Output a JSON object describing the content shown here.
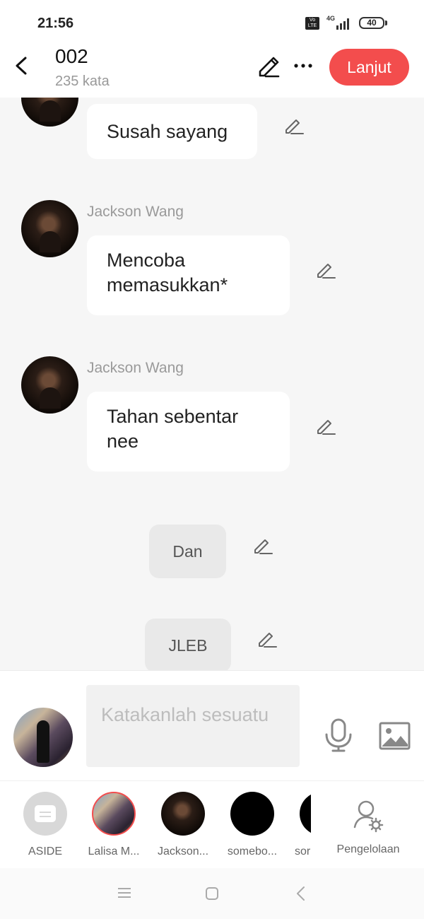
{
  "status_bar": {
    "time": "21:56",
    "volte_label": "Vo LTE",
    "network": "4G",
    "battery": "40"
  },
  "header": {
    "title": "002",
    "word_count": "235 kata",
    "next_label": "Lanjut"
  },
  "chat": {
    "messages": [
      {
        "sender": "",
        "text": "Susah sayang"
      },
      {
        "sender": "Jackson Wang",
        "text": "Mencoba memasukkan*"
      },
      {
        "sender": "Jackson Wang",
        "text": "Tahan sebentar nee"
      }
    ],
    "narrations": [
      {
        "text": "Dan"
      },
      {
        "text": "JLEB"
      }
    ]
  },
  "composer": {
    "placeholder": "Katakanlah sesuatu"
  },
  "characters": [
    {
      "label": "ASIDE"
    },
    {
      "label": "Lalisa M..."
    },
    {
      "label": "Jackson..."
    },
    {
      "label": "somebo..."
    },
    {
      "label": "sor"
    }
  ],
  "manage_label": "Pengelolaan",
  "colors": {
    "accent": "#f34d4d",
    "chat_bg": "#f6f6f6",
    "bubble_bg": "#ffffff",
    "narration_bg": "#e9e9e9"
  }
}
